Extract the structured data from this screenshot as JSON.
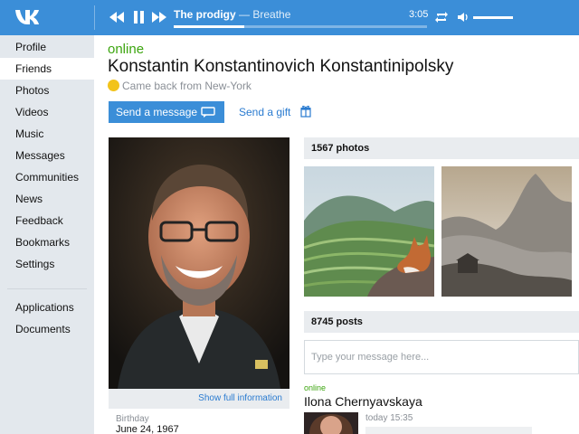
{
  "player": {
    "artist": "The prodigy",
    "separator": "—",
    "song": "Breathe",
    "time": "3:05",
    "progress_fraction": 0.28,
    "volume_fraction": 1.0
  },
  "sidebar": {
    "items": [
      {
        "label": "Profile"
      },
      {
        "label": "Friends"
      },
      {
        "label": "Photos"
      },
      {
        "label": "Videos"
      },
      {
        "label": "Music"
      },
      {
        "label": "Messages"
      },
      {
        "label": "Communities"
      },
      {
        "label": "News"
      },
      {
        "label": "Feedback"
      },
      {
        "label": "Bookmarks"
      },
      {
        "label": "Settings"
      }
    ],
    "extra_items": [
      {
        "label": "Applications"
      },
      {
        "label": "Documents"
      }
    ],
    "active_index": 1
  },
  "profile": {
    "online": "online",
    "name": "Konstantin Konstantinovich Konstantinipolsky",
    "status": "Came back from New-York",
    "send_message": "Send a message",
    "send_gift": "Send a gift",
    "show_info": "Show full information",
    "birthday_label": "Birthday",
    "birthday_value": "June 24, 1967"
  },
  "photos": {
    "heading": "1567 photos"
  },
  "posts": {
    "heading": "8745 posts",
    "placeholder": "Type your message here...",
    "first": {
      "online": "online",
      "author": "Ilona Chernyavskaya",
      "time": "today 15:35"
    }
  },
  "colors": {
    "accent": "#3b8ed8",
    "online": "#3ca50f",
    "link": "#2a7bd0",
    "sidebar_bg": "#e3e8ed"
  }
}
